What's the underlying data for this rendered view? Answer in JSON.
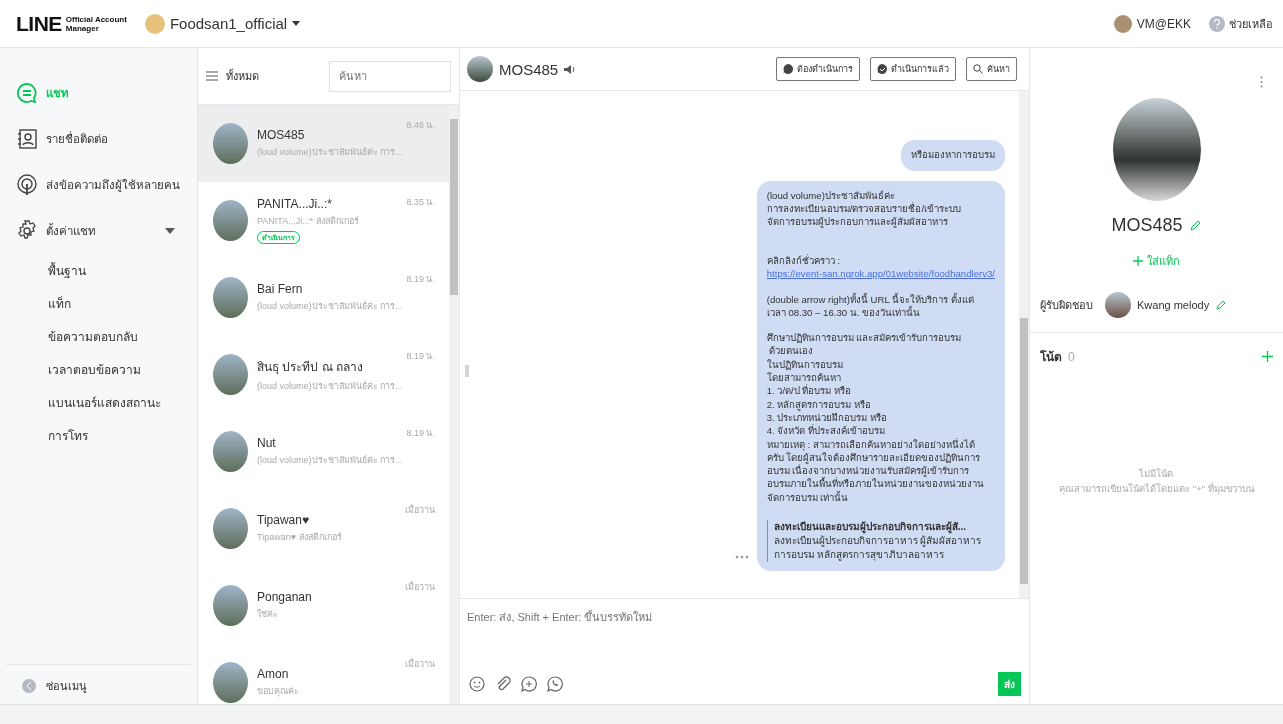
{
  "header": {
    "logo": {
      "wordmark": "LINE",
      "line_1": "Official Account",
      "line_2": "Manager"
    },
    "account": "Foodsan1_official",
    "user": "VM@EKK",
    "help": "ช่วยเหลือ"
  },
  "sidebar": {
    "items": [
      {
        "kind": "chat",
        "label": "แชท",
        "selected": true
      },
      {
        "kind": "contacts",
        "label": "รายชื่อติดต่อ",
        "selected": false
      },
      {
        "kind": "broadcast",
        "label": "ส่งข้อความถึงผู้ใช้หลายคน",
        "selected": false
      },
      {
        "kind": "settings",
        "label": "ตั้งค่าแชท",
        "selected": false,
        "expanded": true,
        "children": [
          {
            "label": "พื้นฐาน"
          },
          {
            "label": "แท็ก"
          },
          {
            "label": "ข้อความตอบกลับ"
          },
          {
            "label": "เวลาตอบข้อความ"
          },
          {
            "label": "แบนเนอร์แสดงสถานะ"
          },
          {
            "label": "การโทร"
          }
        ]
      }
    ],
    "hide_menu": "ซ่อนเมนู"
  },
  "chat_list": {
    "filter": "ทั้งหมด",
    "search": {
      "placeholder": "ค้นหา"
    },
    "items": [
      {
        "name": "MOS485",
        "preview": "(loud volume)ประชาสัมพันธ์ค่ะ การ...",
        "time": "8.46 น.",
        "selected": true
      },
      {
        "name": "PANITA...Ji..:*",
        "preview": "PANITA...Ji..:* ส่งสติกเกอร์",
        "time": "8.35 น.",
        "selected": false,
        "tag": "ดำเนินการ"
      },
      {
        "name": "Bai Fern",
        "preview": "(loud volume)ประชาสัมพันธ์ค่ะ การ...",
        "time": "8.19 น.",
        "selected": false
      },
      {
        "name": "สินธุ ประทีป ณ ถลาง",
        "preview": "(loud volume)ประชาสัมพันธ์ค่ะ การ...",
        "time": "8.19 น.",
        "selected": false
      },
      {
        "name": "Nut",
        "preview": "(loud volume)ประชาสัมพันธ์ค่ะ การ...",
        "time": "8.19 น.",
        "selected": false
      },
      {
        "name": "Tipawan♥",
        "preview": "Tipawan♥ ส่งสติกเกอร์",
        "time": "เมื่อวาน",
        "selected": false
      },
      {
        "name": "Ponganan",
        "preview": "ใช่ค่ะ",
        "time": "เมื่อวาน",
        "selected": false
      },
      {
        "name": "Amon",
        "preview": "ขอบคุณค่ะ",
        "time": "เมื่อวาน",
        "selected": false
      }
    ]
  },
  "chat": {
    "title": "MOS485",
    "buttons": [
      {
        "kind": "todo",
        "label": "ต้องดำเนินการ"
      },
      {
        "kind": "done",
        "label": "ดำเนินการแล้ว"
      },
      {
        "kind": "search",
        "label": "ค้นหา"
      }
    ],
    "messages": [
      {
        "parts": [
          {
            "kind": "text",
            "text": "หรือมองหาการอบรม"
          }
        ]
      },
      {
        "parts": [
          {
            "kind": "text",
            "text": "(loud volume)ประชาสัมพันธ์ค่ะ\nการลงทะเบียนอบรม/ตรวจสอบรายชื่อ/เข้าระบบ\nจัดการอบรมผู้ประกอบการและผู้สัมผัสอาหาร\n\n"
          },
          {
            "kind": "link",
            "prefix": "คลิกลิงก์ชั่วคราว : ",
            "url": "https://event-san.ngrok.app/01website/foodhandlerv3/"
          },
          {
            "kind": "text",
            "text": "(double arrow right)ทั้งนี้ URL นี้จะให้บริการ ตั้งแต่\nเวลา 08.30 – 16.30 น. ของวันเท่านั้น"
          },
          {
            "kind": "text",
            "text": "ศึกษาปฏิทินการอบรม และสมัครเข้ารับการอบรม\n ด้วยตนเอง\nในปฏิทินการอบรม\nโดยสามารถค้นหา\n1. ว/ด/ป ที่อบรม หรือ\n2. หลักสูตรการอบรม หรือ\n3. ประเภทหน่วยฝึกอบรม หรือ\n4. จังหวัด ที่ประสงค์เข้าอบรม\nหมายเหตุ : สามารถเลือกค้นหาอย่างใดอย่างหนึ่งได้\nครับ โดยผู้สนใจต้องศึกษารายละเอียดของปฏิทินการ\nอบรม เนื่องจากบางหน่วยงานรับสมัครผู้เข้ารับการ\nอบรมภายในพื้นที่หรือภายในหน่วยงานของหน่วยงาน\nจัดการอบรม เท่านั้น"
          },
          {
            "kind": "preview",
            "title": "ลงทะเบียนและอบรมผู้ประกอบกิจการและผู้สั...",
            "text": "ลงทะเบียนผู้ประกอบกิจการอาหาร ผู้สัมผัสอาหาร\nการอบรม หลักสูตรการสุขาภิบาลอาหาร"
          }
        ]
      }
    ],
    "composer": {
      "placeholder": "Enter: ส่ง, Shift + Enter: ขึ้นบรรทัดใหม่",
      "send": "ส่ง"
    }
  },
  "profile": {
    "name": "MOS485",
    "add_tag": "ใส่แท็ก",
    "assignee_label": "ผู้รับผิดชอบ",
    "assignee": "Kwang melody",
    "notes_title": "โน้ต",
    "notes_count": "0",
    "empty_title": "ไม่มีโน้ต",
    "empty_hint": "คุณสามารถเขียนโน้ตได้โดยแตะ \"+\" ที่มุมขวาบน"
  }
}
